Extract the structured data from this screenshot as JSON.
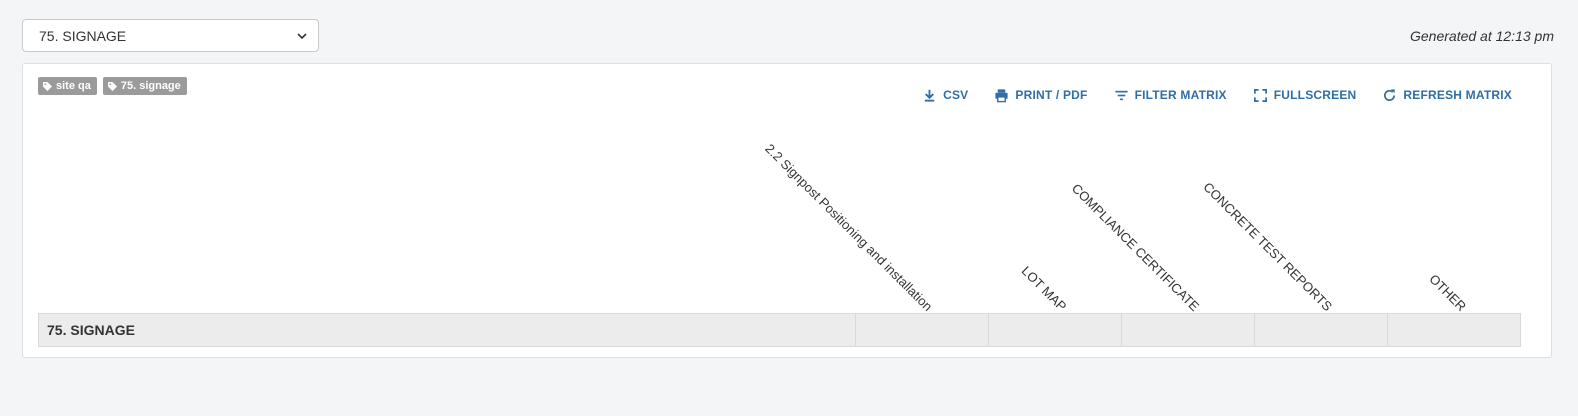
{
  "selector": {
    "value": "75. SIGNAGE"
  },
  "generated": "Generated at 12:13 pm",
  "tags": [
    {
      "label": "site qa",
      "icon": "tag-icon"
    },
    {
      "label": "75. signage",
      "icon": "tag-icon"
    }
  ],
  "toolbar": {
    "csv": "CSV",
    "print": "PRINT / PDF",
    "filter": "FILTER MATRIX",
    "fullscreen": "FULLSCREEN",
    "refresh": "REFRESH MATRIX"
  },
  "columns": [
    "2.2 Signpost Positioning and installation",
    "LOT MAP",
    "COMPLIANCE CERTIFICATE",
    "CONCRETE TEST REPORTS",
    "OTHER"
  ],
  "rows": [
    {
      "label": "75. SIGNAGE"
    }
  ],
  "colors": {
    "accent": "#2f6ea6",
    "tag_bg": "#9b9b9b",
    "row_bg": "#ececec"
  }
}
